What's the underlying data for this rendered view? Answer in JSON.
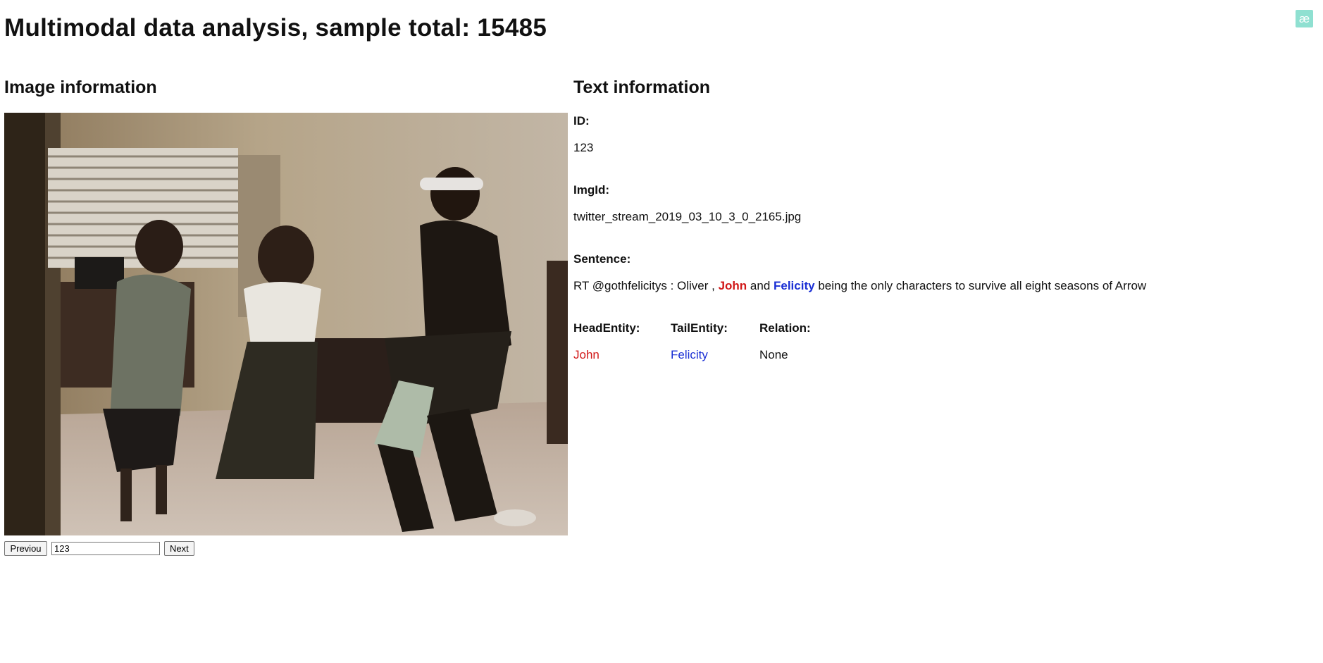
{
  "header": {
    "title": "Multimodal data analysis, sample total: 15485",
    "logo_text": "æ"
  },
  "image_section": {
    "title": "Image information"
  },
  "text_section": {
    "title": "Text information"
  },
  "pager": {
    "prev_label": "Previou",
    "page_value": "123",
    "next_label": "Next"
  },
  "record": {
    "id_label": "ID:",
    "id_value": "123",
    "imgid_label": "ImgId:",
    "imgid_value": "twitter_stream_2019_03_10_3_0_2165.jpg",
    "sentence_label": "Sentence:",
    "sentence_parts": {
      "before": "RT @gothfelicitys : Oliver , ",
      "head": "John",
      "middle": " and ",
      "tail": "Felicity",
      "after": " being the only characters to survive all eight seasons of Arrow"
    },
    "head_entity_label": "HeadEntity:",
    "head_entity_value": "John",
    "tail_entity_label": "TailEntity:",
    "tail_entity_value": "Felicity",
    "relation_label": "Relation:",
    "relation_value": "None"
  },
  "colors": {
    "head_entity": "#d11818",
    "tail_entity": "#1a2fd4",
    "logo_bg": "#8fe0d1"
  }
}
